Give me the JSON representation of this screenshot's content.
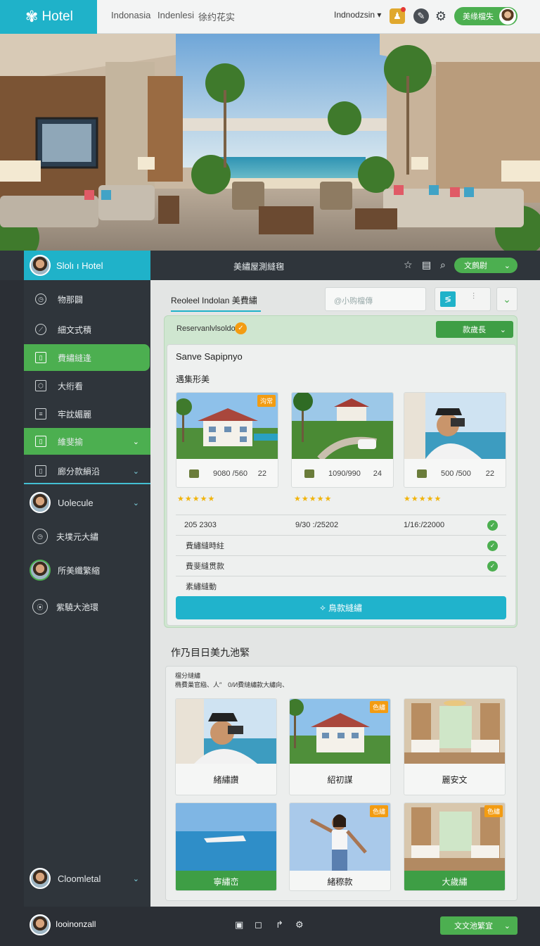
{
  "app": {
    "logo_text": "Hotel"
  },
  "topbar": {
    "links": [
      "Indonasia",
      "Indenlesi",
      "徐约花实"
    ],
    "language": "Indnodzsin",
    "user_button": "美缘檔失"
  },
  "navbar": {
    "brand": "Slolı ı Hotel",
    "title": "美繡屋測縫毱",
    "button": "文鹧尉"
  },
  "sidebar": {
    "items": [
      {
        "label": "物那闢"
      },
      {
        "label": "細文式積"
      },
      {
        "label": "費繡縫逢"
      },
      {
        "label": "大绗看"
      },
      {
        "label": "牢訦媚麗"
      },
      {
        "label": "維斐揄"
      },
      {
        "label": "廊分款縜沿"
      }
    ],
    "users": [
      {
        "name": "Uolecule"
      },
      {
        "name": "夫墣元大繡"
      },
      {
        "name": "所美纖繁縮"
      },
      {
        "name": "紫驍大池環"
      }
    ],
    "footer_user": "Cloomletal"
  },
  "main": {
    "tab": "Reoleel Indolan 美費繡",
    "search_placeholder": "@小购檔傳"
  },
  "reservation": {
    "title": "Reservanlvlsoldo",
    "badge": "✓",
    "button": "款歲長",
    "card_title": "Sanve Sapipnyo",
    "card_subtitle": "遇集形美",
    "rooms": [
      {
        "price": "9080 /560",
        "count": "22",
        "tag": "沟常",
        "rating": "★★★★★"
      },
      {
        "price": "1090/990",
        "count": "24",
        "tag": "",
        "rating": "★★★★★"
      },
      {
        "price": "500 /500",
        "count": "22",
        "tag": "",
        "rating": "★★★★★"
      }
    ],
    "rows": [
      {
        "a": "205 2303",
        "b": "9/30 :/25202",
        "c": "1/16:/22000"
      },
      {
        "a": "費繡縫時紸",
        "b": "",
        "c": ""
      },
      {
        "a": "費斐縫贯款",
        "b": "",
        "c": ""
      },
      {
        "a": "素繡縫動",
        "b": "",
        "c": ""
      }
    ],
    "book_button": "鳥款縫繡"
  },
  "gallery": {
    "title": "作乃目日美九池緊",
    "sub1": "檔分縫繡",
    "sub2": "椭費巢官繈、人″  0/И費縫繡款大繡向、",
    "cards": [
      {
        "label": "緒繡讚",
        "tag": ""
      },
      {
        "label": "紹初謀",
        "tag": "色繡"
      },
      {
        "label": "麗安文",
        "tag": ""
      },
      {
        "label": "寧繡峦",
        "tag": ""
      },
      {
        "label": "緒穄款",
        "tag": "色繡"
      },
      {
        "label": "大歲繡",
        "tag": "色繡"
      }
    ]
  },
  "bottombar": {
    "user": "Iooinonzall",
    "button": "文文池繁宜"
  }
}
